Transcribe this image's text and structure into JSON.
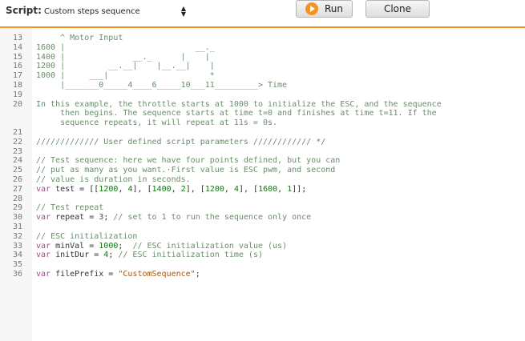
{
  "toolbar": {
    "script_label": "Script:",
    "script_selected": "Custom steps sequence",
    "run_label": "Run",
    "clone_label": "Clone",
    "accent_color": "#f39322"
  },
  "editor": {
    "lines": [
      {
        "n": "13",
        "parts": [
          {
            "t": "     ^ Motor Input",
            "c": "c"
          }
        ]
      },
      {
        "n": "14",
        "parts": [
          {
            "t": "1600 |                           __._",
            "c": "c"
          }
        ]
      },
      {
        "n": "15",
        "parts": [
          {
            "t": "1400 |              __._      |    |",
            "c": "c"
          }
        ]
      },
      {
        "n": "16",
        "parts": [
          {
            "t": "1200 |         __.__|    |__.__|    |",
            "c": "c"
          }
        ]
      },
      {
        "n": "17",
        "parts": [
          {
            "t": "1000 |     ___|                     *",
            "c": "c"
          }
        ]
      },
      {
        "n": "18",
        "parts": [
          {
            "t": "     |_______0_____4____6_____10___11_________> Time",
            "c": "c"
          }
        ]
      },
      {
        "n": "19",
        "parts": [
          {
            "t": "",
            "c": "c"
          }
        ]
      },
      {
        "n": "20",
        "parts": [
          {
            "t": "In this example, the throttle starts at 1000 to initialize the ESC, and the sequence",
            "c": "c"
          }
        ]
      },
      {
        "n": "",
        "parts": [
          {
            "t": "     then begins. The sequence starts at time t=0 and finishes at time t=11. If the",
            "c": "c"
          }
        ]
      },
      {
        "n": "",
        "parts": [
          {
            "t": "     sequence repeats, it will repeat at 11s = 0s.",
            "c": "c"
          }
        ]
      },
      {
        "n": "21",
        "parts": [
          {
            "t": "",
            "c": "c"
          }
        ]
      },
      {
        "n": "22",
        "parts": [
          {
            "t": "///////////// User defined script parameters //////////// */",
            "c": "c"
          }
        ]
      },
      {
        "n": "23",
        "parts": [
          {
            "t": "",
            "c": "c"
          }
        ]
      },
      {
        "n": "24",
        "parts": [
          {
            "t": "// Test sequence: here we have four points defined, but you can",
            "c": "c"
          }
        ]
      },
      {
        "n": "25",
        "parts": [
          {
            "t": "// put as many as you want.·First value is ESC pwm, and second",
            "c": "c"
          }
        ]
      },
      {
        "n": "26",
        "parts": [
          {
            "t": "// value is duration in seconds.",
            "c": "c"
          }
        ]
      },
      {
        "n": "27",
        "parts": [
          {
            "t": "var",
            "c": "k"
          },
          {
            "t": " test = [[",
            "c": ""
          },
          {
            "t": "1200",
            "c": "n"
          },
          {
            "t": ", ",
            "c": ""
          },
          {
            "t": "4",
            "c": "n"
          },
          {
            "t": "], [",
            "c": ""
          },
          {
            "t": "1400",
            "c": "n"
          },
          {
            "t": ", ",
            "c": ""
          },
          {
            "t": "2",
            "c": "n"
          },
          {
            "t": "], [",
            "c": ""
          },
          {
            "t": "1200",
            "c": "n"
          },
          {
            "t": ", ",
            "c": ""
          },
          {
            "t": "4",
            "c": "n"
          },
          {
            "t": "], [",
            "c": ""
          },
          {
            "t": "1600",
            "c": "n"
          },
          {
            "t": ", ",
            "c": ""
          },
          {
            "t": "1",
            "c": "n"
          },
          {
            "t": "]];",
            "c": ""
          }
        ]
      },
      {
        "n": "28",
        "parts": [
          {
            "t": "",
            "c": ""
          }
        ]
      },
      {
        "n": "29",
        "parts": [
          {
            "t": "// Test repeat",
            "c": "c"
          }
        ]
      },
      {
        "n": "30",
        "parts": [
          {
            "t": "var",
            "c": "k"
          },
          {
            "t": " repeat = ",
            "c": ""
          },
          {
            "t": "3",
            "c": "n"
          },
          {
            "t": "; ",
            "c": ""
          },
          {
            "t": "// set to 1 to run the sequence only once",
            "c": "c"
          }
        ]
      },
      {
        "n": "31",
        "parts": [
          {
            "t": "",
            "c": ""
          }
        ]
      },
      {
        "n": "32",
        "parts": [
          {
            "t": "// ESC initialization",
            "c": "c"
          }
        ]
      },
      {
        "n": "33",
        "parts": [
          {
            "t": "var",
            "c": "k"
          },
          {
            "t": " minVal = ",
            "c": ""
          },
          {
            "t": "1000",
            "c": "n"
          },
          {
            "t": ";  ",
            "c": ""
          },
          {
            "t": "// ESC initialization value (us)",
            "c": "c"
          }
        ]
      },
      {
        "n": "34",
        "parts": [
          {
            "t": "var",
            "c": "k"
          },
          {
            "t": " initDur = ",
            "c": ""
          },
          {
            "t": "4",
            "c": "n"
          },
          {
            "t": "; ",
            "c": ""
          },
          {
            "t": "// ESC initialization time (s)",
            "c": "c"
          }
        ]
      },
      {
        "n": "35",
        "parts": [
          {
            "t": "",
            "c": ""
          }
        ]
      },
      {
        "n": "36",
        "parts": [
          {
            "t": "var",
            "c": "k"
          },
          {
            "t": " filePrefix = ",
            "c": ""
          },
          {
            "t": "\"CustomSequence\"",
            "c": "s"
          },
          {
            "t": ";",
            "c": ""
          }
        ]
      }
    ]
  }
}
